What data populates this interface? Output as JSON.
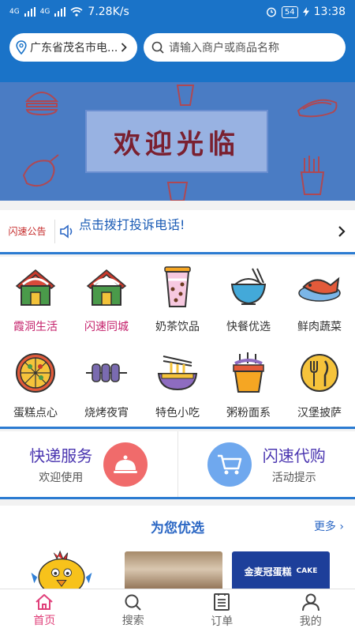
{
  "status_bar": {
    "network1": "4G",
    "network2": "4G",
    "speed": "7.28K/s",
    "battery": "54",
    "time": "13:38"
  },
  "header": {
    "location": "广东省茂名市电...",
    "search_placeholder": "请输入商户或商品名称"
  },
  "banner": {
    "text": "欢迎光临"
  },
  "notice": {
    "title": "闪速公告",
    "text": "点击拨打投诉电话!"
  },
  "categories": [
    {
      "label": "霞洞生活",
      "icon": "house-icon",
      "color": "#c41f6a"
    },
    {
      "label": "闪速同城",
      "icon": "house-icon",
      "color": "#c41f6a"
    },
    {
      "label": "奶茶饮品",
      "icon": "milk-tea-icon",
      "color": "#333333"
    },
    {
      "label": "快餐优选",
      "icon": "rice-bowl-icon",
      "color": "#333333"
    },
    {
      "label": "鲜肉蔬菜",
      "icon": "fish-icon",
      "color": "#333333"
    },
    {
      "label": "蛋糕点心",
      "icon": "pizza-icon",
      "color": "#333333"
    },
    {
      "label": "烧烤夜宵",
      "icon": "skewer-icon",
      "color": "#333333"
    },
    {
      "label": "特色小吃",
      "icon": "noodles-icon",
      "color": "#333333"
    },
    {
      "label": "粥粉面系",
      "icon": "noodle-cup-icon",
      "color": "#333333"
    },
    {
      "label": "汉堡披萨",
      "icon": "fork-knife-icon",
      "color": "#333333"
    }
  ],
  "services": [
    {
      "title": "快递服务",
      "subtitle": "欢迎使用",
      "icon": "cloche-icon",
      "color": "#f06b6b"
    },
    {
      "title": "闪速代购",
      "subtitle": "活动提示",
      "icon": "cart-icon",
      "color": "#6fa8ee"
    }
  ],
  "recommend": {
    "title": "为您优选",
    "more": "更多",
    "cake_sign": "金麦冠蛋糕",
    "cake_sign_en": "CAKE"
  },
  "tabs": [
    {
      "label": "首页",
      "icon": "home-icon",
      "active": true
    },
    {
      "label": "搜索",
      "icon": "search-icon",
      "active": false
    },
    {
      "label": "订单",
      "icon": "order-list-icon",
      "active": false
    },
    {
      "label": "我的",
      "icon": "user-icon",
      "active": false
    }
  ],
  "colors": {
    "primary": "#1a73c8",
    "accent": "#e0407a",
    "banner": "#4a7cc4"
  }
}
